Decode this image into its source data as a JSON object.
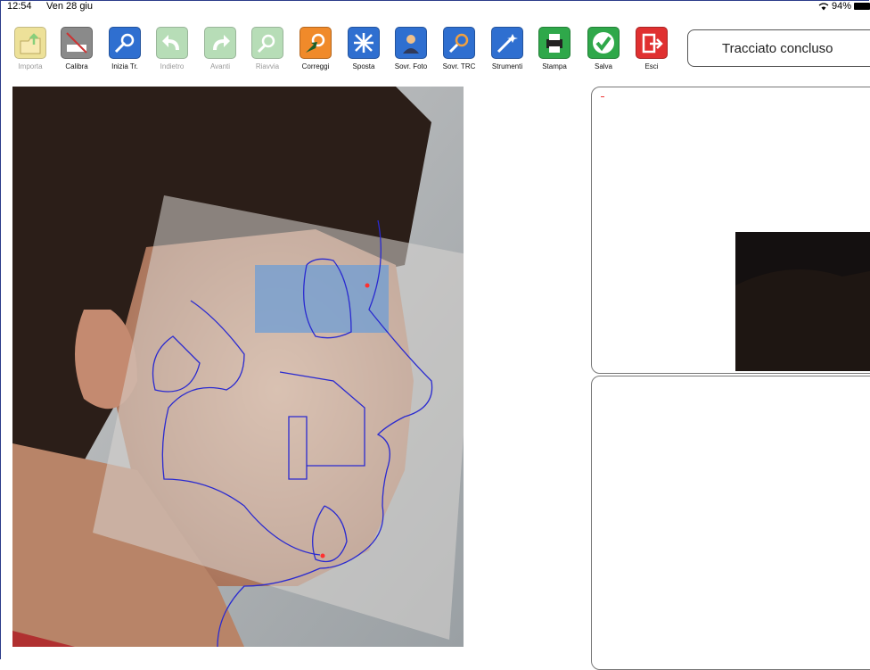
{
  "statusbar": {
    "time": "12:54",
    "date": "Ven 28 giu",
    "battery": "94%"
  },
  "toolbar": {
    "tools": [
      {
        "label": "Importa",
        "icon": "folder-import-icon",
        "color": "#e8d878",
        "disabled": true
      },
      {
        "label": "Calibra",
        "icon": "ruler-calibrate-icon",
        "color": "#8a8a8a",
        "disabled": false
      },
      {
        "label": "Inizia Tr.",
        "icon": "trace-start-icon",
        "color": "#2f6fd0",
        "disabled": false
      },
      {
        "label": "Indietro",
        "icon": "undo-arrow-icon",
        "color": "#9fd29f",
        "disabled": true
      },
      {
        "label": "Avanti",
        "icon": "redo-arrow-icon",
        "color": "#9fd29f",
        "disabled": true
      },
      {
        "label": "Riavvia",
        "icon": "restart-trace-icon",
        "color": "#9fd29f",
        "disabled": true
      },
      {
        "label": "Correggi",
        "icon": "correct-point-icon",
        "color": "#f08a2a",
        "disabled": false
      },
      {
        "label": "Sposta",
        "icon": "move-arrows-icon",
        "color": "#2f6fd0",
        "disabled": false
      },
      {
        "label": "Sovr. Foto",
        "icon": "overlay-photo-icon",
        "color": "#2f6fd0",
        "disabled": false
      },
      {
        "label": "Sovr. TRC",
        "icon": "overlay-trace-icon",
        "color": "#2f6fd0",
        "disabled": false
      },
      {
        "label": "Strumenti",
        "icon": "magic-wand-icon",
        "color": "#2f6fd0",
        "disabled": false
      },
      {
        "label": "Stampa",
        "icon": "printer-icon",
        "color": "#2fa84a",
        "disabled": false
      },
      {
        "label": "Salva",
        "icon": "checkmark-icon",
        "color": "#2fa84a",
        "disabled": false
      },
      {
        "label": "Esci",
        "icon": "exit-door-icon",
        "color": "#e03030",
        "disabled": false
      }
    ]
  },
  "status_message": "Tracciato concluso"
}
